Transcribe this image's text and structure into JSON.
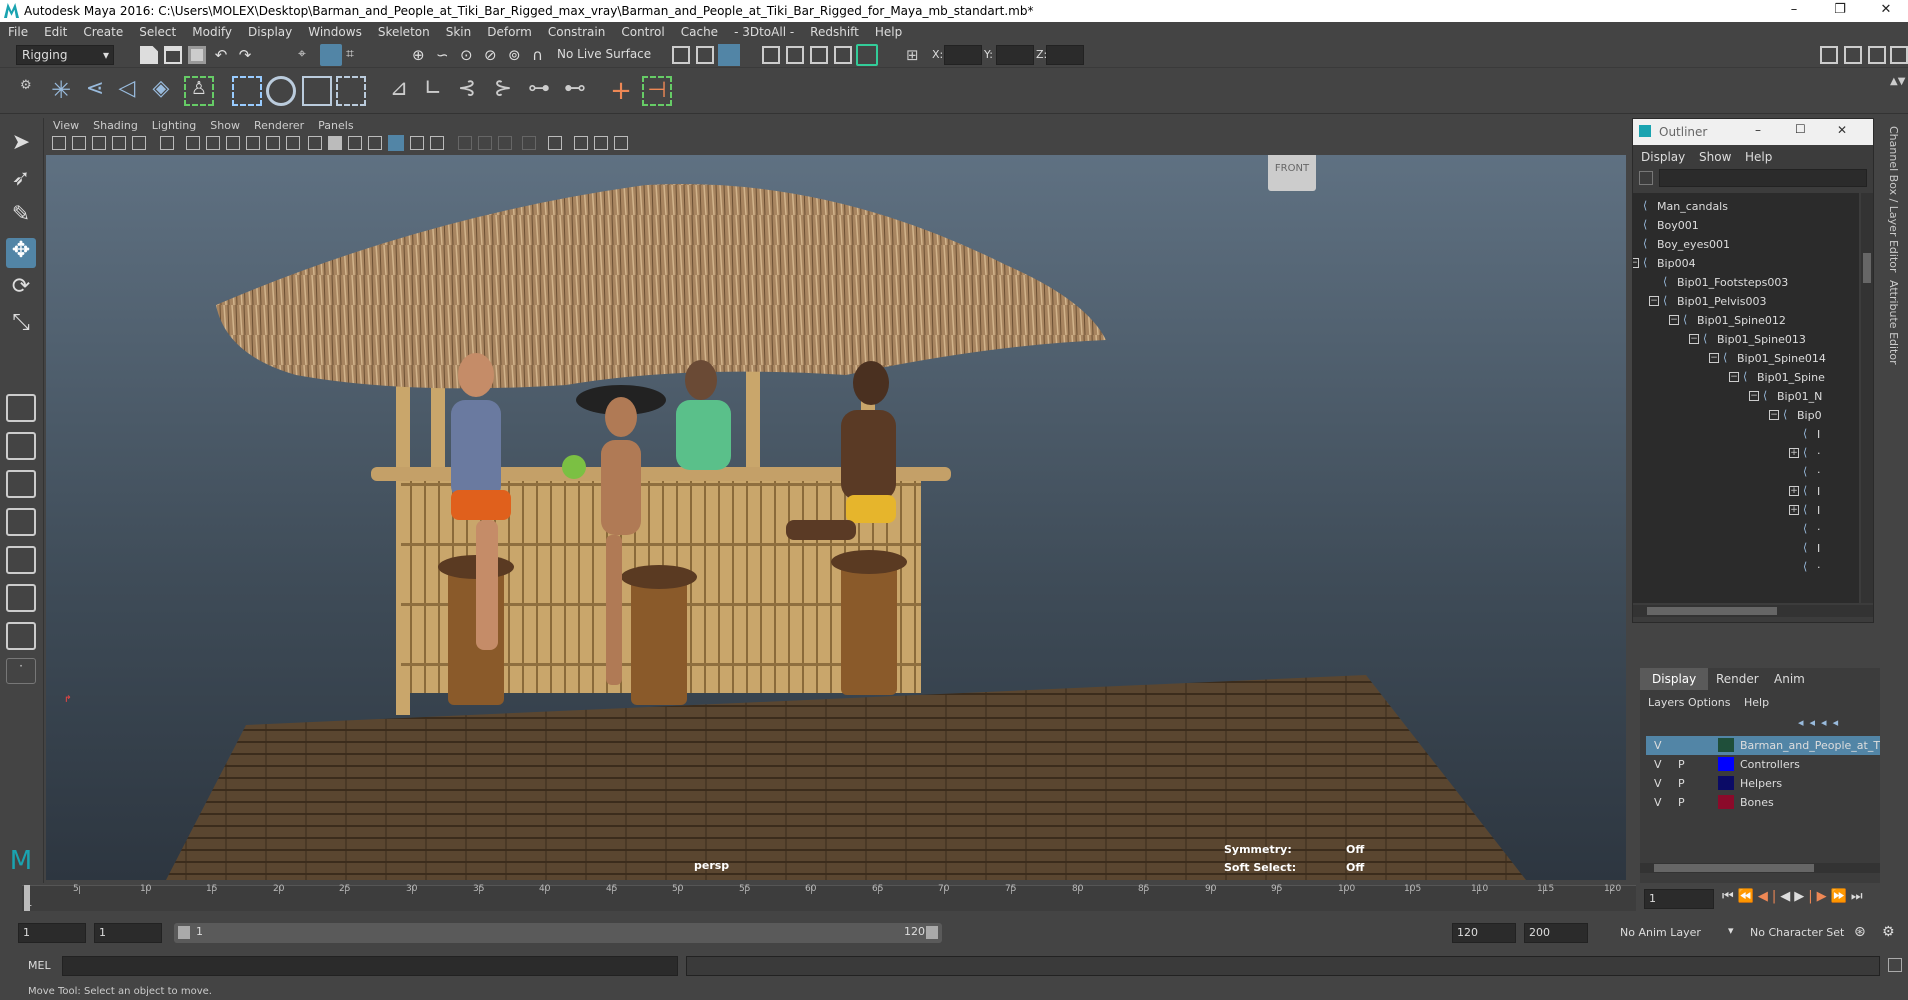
{
  "window": {
    "title": "Autodesk Maya 2016: C:\\Users\\MOLEX\\Desktop\\Barman_and_People_at_Tiki_Bar_Rigged_max_vray\\Barman_and_People_at_Tiki_Bar_Rigged_for_Maya_mb_standart.mb*",
    "minimize": "–",
    "restore": "❐",
    "close": "✕"
  },
  "menu": [
    "File",
    "Edit",
    "Create",
    "Select",
    "Modify",
    "Display",
    "Windows",
    "Skeleton",
    "Skin",
    "Deform",
    "Constrain",
    "Control",
    "Cache",
    "- 3DtoAll -",
    "Redshift",
    "Help"
  ],
  "status": {
    "menuset": "Rigging",
    "live_surface": "No Live Surface",
    "x_label": "X:",
    "y_label": "Y:",
    "z_label": "Z:"
  },
  "panel_menu": [
    "View",
    "Shading",
    "Lighting",
    "Show",
    "Renderer",
    "Panels"
  ],
  "viewport": {
    "camera": "persp",
    "viewcube": "FRONT",
    "symmetry_label": "Symmetry:",
    "symmetry_value": "Off",
    "soft_select_label": "Soft Select:",
    "soft_select_value": "Off"
  },
  "outliner": {
    "title": "Outliner",
    "menu": [
      "Display",
      "Show",
      "Help"
    ],
    "items": [
      {
        "label": "Man_candals",
        "depth": 0
      },
      {
        "label": "Boy001",
        "depth": 0
      },
      {
        "label": "Boy_eyes001",
        "depth": 0
      },
      {
        "label": "Bip004",
        "depth": 0,
        "exp": "−"
      },
      {
        "label": "Bip01_Footsteps003",
        "depth": 1
      },
      {
        "label": "Bip01_Pelvis003",
        "depth": 1,
        "exp": "−"
      },
      {
        "label": "Bip01_Spine012",
        "depth": 2,
        "exp": "−"
      },
      {
        "label": "Bip01_Spine013",
        "depth": 3,
        "exp": "−"
      },
      {
        "label": "Bip01_Spine014",
        "depth": 4,
        "exp": "−"
      },
      {
        "label": "Bip01_Spine",
        "depth": 5,
        "exp": "−"
      },
      {
        "label": "Bip01_N",
        "depth": 6,
        "exp": "−"
      },
      {
        "label": "Bip0",
        "depth": 7,
        "exp": "−"
      },
      {
        "label": "I",
        "depth": 8
      },
      {
        "label": "·",
        "depth": 8,
        "exp": "+"
      },
      {
        "label": "·",
        "depth": 8
      },
      {
        "label": "I",
        "depth": 8,
        "exp": "+"
      },
      {
        "label": "I",
        "depth": 8,
        "exp": "+"
      },
      {
        "label": "·",
        "depth": 8
      },
      {
        "label": "I",
        "depth": 8
      },
      {
        "label": "·",
        "depth": 8
      }
    ]
  },
  "layers": {
    "tabs": [
      "Display",
      "Render",
      "Anim"
    ],
    "menu": [
      "Layers",
      "Options",
      "Help"
    ],
    "rows": [
      {
        "v": "V",
        "p": "",
        "color": "#1f4f3a",
        "name": "Barman_and_People_at_Tiki_Ba",
        "selected": true
      },
      {
        "v": "V",
        "p": "P",
        "color": "#0000ff",
        "name": "Controllers",
        "selected": false
      },
      {
        "v": "V",
        "p": "P",
        "color": "#0b0b66",
        "name": "Helpers",
        "selected": false
      },
      {
        "v": "V",
        "p": "P",
        "color": "#8b0a2a",
        "name": "Bones",
        "selected": false
      }
    ]
  },
  "side_tabs": [
    "Channel Box / Layer Editor",
    "Attribute Editor"
  ],
  "timeline": {
    "ticks": [
      "5",
      "10",
      "15",
      "20",
      "25",
      "30",
      "35",
      "40",
      "45",
      "50",
      "55",
      "60",
      "65",
      "70",
      "75",
      "80",
      "85",
      "90",
      "95",
      "100",
      "105",
      "110",
      "115",
      "120"
    ],
    "start_tick": "1",
    "current_frame": "1"
  },
  "range": {
    "start": "1",
    "playback_start": "1",
    "slider_start": "1",
    "slider_end": "120",
    "end": "120",
    "anim_end": "200",
    "anim_layer": "No Anim Layer",
    "char_set": "No Character Set"
  },
  "cmd": {
    "label": "MEL"
  },
  "help": {
    "text": "Move Tool: Select an object to move."
  }
}
